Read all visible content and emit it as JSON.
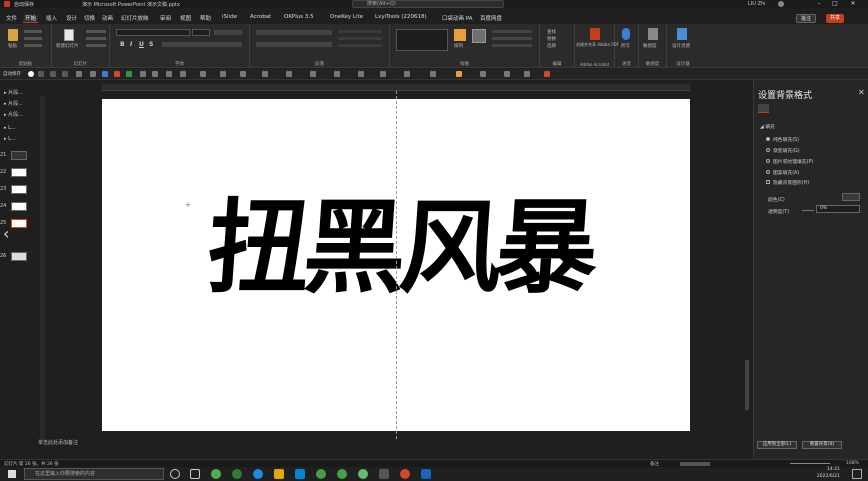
{
  "titlebar": {
    "autosave": "自动保存",
    "filename": "演示 Microsoft PowerPoint 演示文稿.pptx",
    "search_placeholder": "搜索(Alt+Q)",
    "user": "LIU Zhi"
  },
  "menu": {
    "items": [
      "文件",
      "开始",
      "插入",
      "设计",
      "切换",
      "动画",
      "幻灯片放映",
      "审阅",
      "视图",
      "帮助",
      "iSlide",
      "Acrobat",
      "OKPlus 3.5",
      "OneKey Lite",
      "LvyiTools (220618)",
      "口袋动画 PA",
      "百度网盘"
    ],
    "active_index": 1,
    "comment_label": "批注",
    "share_label": "共享"
  },
  "ribbon": {
    "groups": [
      "剪贴板",
      "幻灯片",
      "字体",
      "段落",
      "绘图",
      "编辑",
      "Adobe Acrobat",
      "语音",
      "敏感度",
      "设计器"
    ],
    "paste_label": "粘贴",
    "new_slide_label": "新建幻灯片",
    "arrange_label": "排列",
    "find_label": "查找",
    "replace_label": "替换",
    "select_label": "选择",
    "pdf_label": "创建并共享 Adobe PDF",
    "dictate_label": "听写",
    "sensitivity_label": "敏感度",
    "designer_label": "设计灵感"
  },
  "qat": {
    "label": "自动保存"
  },
  "left_panel": {
    "sections": [
      "片段...",
      "片段...",
      "片段...",
      "L..."
    ],
    "thumbnails": [
      "21",
      "22",
      "23",
      "24",
      "25",
      "26"
    ]
  },
  "slide": {
    "title_text": "扭黑风暴",
    "notes_placeholder": "单击此处添加备注"
  },
  "format_pane": {
    "title": "设置背景格式",
    "section": "填充",
    "options": [
      "纯色填充(S)",
      "渐变填充(G)",
      "图片或纹理填充(P)",
      "图案填充(A)"
    ],
    "hide_bg_label": "隐藏背景图形(H)",
    "color_label": "颜色(C)",
    "transparency_label": "透明度(T)",
    "transparency_value": "0%",
    "apply_all_label": "应用到全部(L)",
    "reset_label": "重置背景(B)"
  },
  "statusbar": {
    "left_text": "幻灯片 第 26 张，共 26 张",
    "notes_label": "备注",
    "zoom": "108%"
  },
  "taskbar": {
    "search_placeholder": "在这里输入你要搜索的内容",
    "time": "14:21",
    "date": "2022/6/21"
  },
  "colors": {
    "accent": "#c43e1c",
    "slide_bg": "#ffffff",
    "app_bg": "#1f1f1f"
  }
}
